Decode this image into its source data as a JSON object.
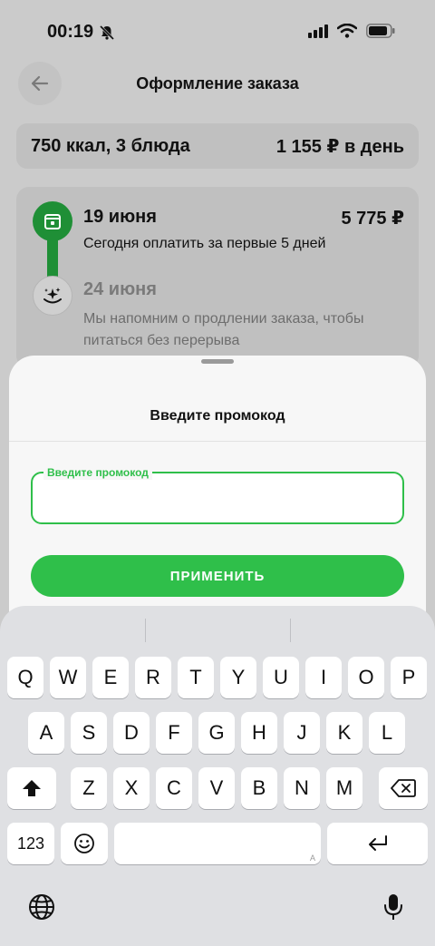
{
  "status": {
    "time": "00:19"
  },
  "nav": {
    "title": "Оформление заказа"
  },
  "summary": {
    "left": "750 ккал, 3 блюда",
    "right": "1 155 ₽ в день"
  },
  "timeline": {
    "first": {
      "date": "19 июня",
      "price": "5 775 ₽",
      "desc": "Сегодня оплатить за первые 5 дней"
    },
    "second": {
      "date": "24 июня",
      "desc": "Мы напомним о продлении заказа, чтобы питаться без перерыва"
    }
  },
  "sheet": {
    "title": "Введите промокод",
    "input_label": "Введите промокод",
    "input_value": "",
    "apply_label": "ПРИМЕНИТЬ"
  },
  "keyboard": {
    "row1": [
      "Q",
      "W",
      "E",
      "R",
      "T",
      "Y",
      "U",
      "I",
      "O",
      "P"
    ],
    "row2": [
      "A",
      "S",
      "D",
      "F",
      "G",
      "H",
      "J",
      "K",
      "L"
    ],
    "row3": [
      "Z",
      "X",
      "C",
      "V",
      "B",
      "N",
      "M"
    ],
    "numbers_label": "123",
    "space_hint": "A"
  },
  "colors": {
    "accent": "#2fbf4a",
    "accent_dark": "#1f8f36"
  }
}
